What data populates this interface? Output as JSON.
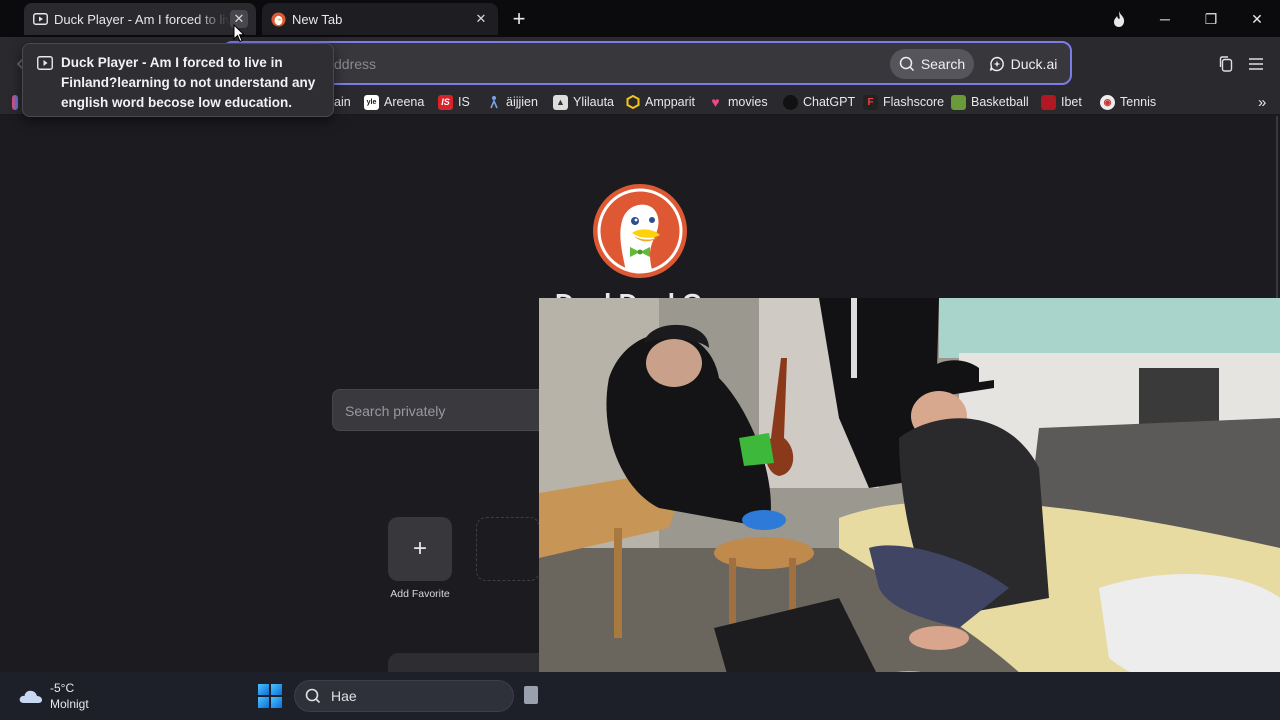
{
  "tabs": [
    {
      "title": "Duck Player - Am I forced to live in Finland",
      "close": "✕",
      "active": true
    },
    {
      "title": "New Tab",
      "close": "✕",
      "active": false
    }
  ],
  "new_tab_symbol": "+",
  "window_controls": {
    "fire": "fire-icon",
    "minimize": "─",
    "restore": "❐",
    "close": "✕"
  },
  "addressbar": {
    "placeholder": "ddress",
    "search_label": "Search",
    "duckai_label": "Duck.ai"
  },
  "bookmarks": [
    {
      "label": "ain",
      "icon": ""
    },
    {
      "label": "Areena",
      "icon": "yle"
    },
    {
      "label": "IS",
      "icon": "IS"
    },
    {
      "label": "äijjien",
      "icon": "figure"
    },
    {
      "label": "Ylilauta",
      "icon": "yl"
    },
    {
      "label": "Ampparit",
      "icon": "a"
    },
    {
      "label": "movies",
      "icon": "heart"
    },
    {
      "label": "ChatGPT",
      "icon": "gpt"
    },
    {
      "label": "Flashscore",
      "icon": "fs"
    },
    {
      "label": "Basketball",
      "icon": "bb"
    },
    {
      "label": "Ibet",
      "icon": "ib"
    },
    {
      "label": "Tennis",
      "icon": "tn"
    }
  ],
  "bookmarks_overflow": "»",
  "tooltip": {
    "text": "Duck Player - Am I forced to live in Finland?learning to not understand any english word becose low education."
  },
  "newtab": {
    "wordmark": "DuckDuckGo",
    "search_placeholder": "Search privately",
    "add_favorite_symbol": "+",
    "add_favorite_label": "Add Favorite"
  },
  "taskbar": {
    "temperature": "-5°C",
    "condition": "Molnigt",
    "search_label": "Hae"
  },
  "colors": {
    "accent_focus": "#7b7ce8",
    "duck_orange": "#de5833",
    "chrome_bg": "#2a292e",
    "page_bg": "#1c1b1f"
  }
}
